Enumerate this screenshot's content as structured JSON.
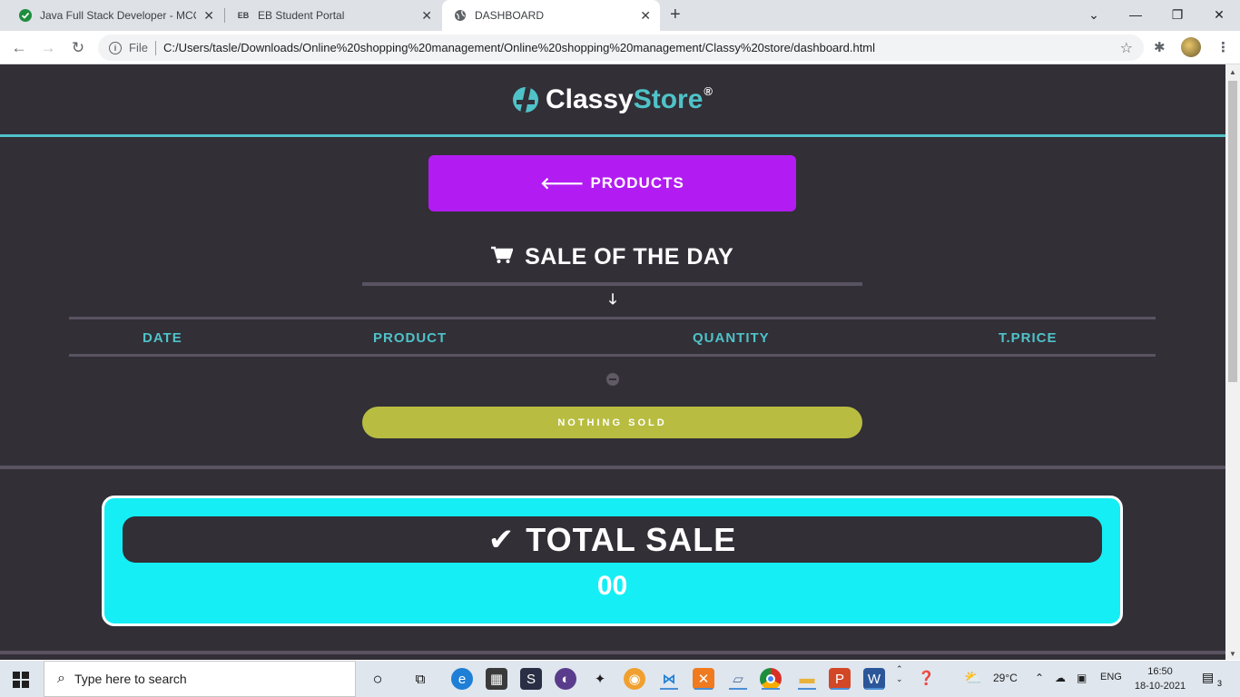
{
  "browser": {
    "tabs": [
      {
        "title": "Java Full Stack Developer - MCQ",
        "icon": "check-circle-icon",
        "active": false
      },
      {
        "title": "EB Student Portal",
        "icon": "portal-icon",
        "active": false
      },
      {
        "title": "DASHBOARD",
        "icon": "globe-icon",
        "active": true
      }
    ],
    "address": {
      "scheme_label": "File",
      "url": "C:/Users/tasle/Downloads/Online%20shopping%20management/Online%20shopping%20management/Classy%20store/dashboard.html"
    }
  },
  "page": {
    "brand": {
      "part1": "Classy",
      "part2": "Store",
      "mark": "®"
    },
    "products_button": {
      "label": "PRODUCTS",
      "icon": "arrow-left-icon"
    },
    "sale_section": {
      "title": "SALE OF THE DAY",
      "icon": "cart-icon",
      "columns": [
        "DATE",
        "PRODUCT",
        "QUANTITY",
        "T.PRICE"
      ],
      "empty_label": "NOTHING SOLD"
    },
    "total": {
      "label": "TOTAL SALE",
      "value": "00",
      "icon": "check-icon"
    },
    "colors": {
      "background": "#322f37",
      "accent": "#4fc3c8",
      "products_button": "#b21cf2",
      "nothing_sold": "#b8bd41",
      "total_box": "#15eef5"
    }
  },
  "taskbar": {
    "search_placeholder": "Type here to search",
    "weather": "29°C",
    "language": "ENG",
    "time": "16:50",
    "date": "18-10-2021",
    "notification_count": "3"
  }
}
